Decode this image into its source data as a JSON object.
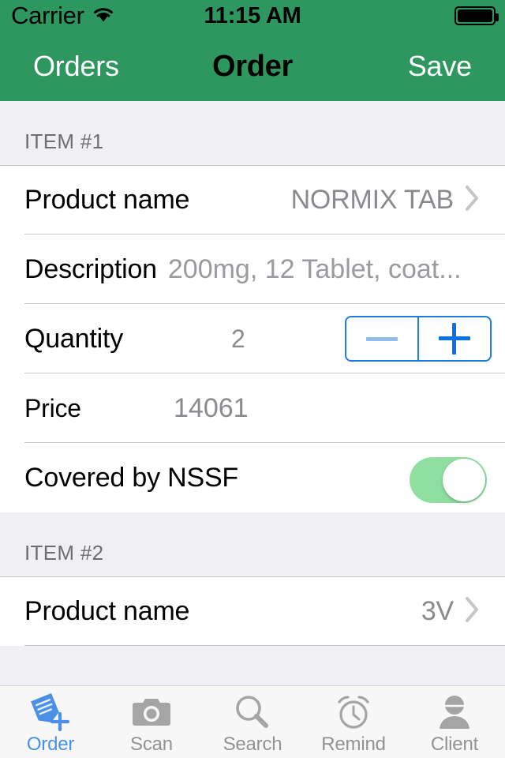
{
  "statusbar": {
    "carrier": "Carrier",
    "wifi_icon": "wifi-icon",
    "time": "11:15 AM",
    "battery_icon": "battery-full-icon"
  },
  "navbar": {
    "back_label": "Orders",
    "title": "Order",
    "save_label": "Save"
  },
  "colors": {
    "navbar_green": "#2E9760",
    "section_bg": "#EFEFF4",
    "accent_blue": "#0A72E8",
    "toggle_on_green": "#8FDFA0",
    "tab_active_blue": "#4A90E8",
    "separator": "#C8C7CC",
    "value_gray": "#8A8A8F"
  },
  "sections": [
    {
      "header": "ITEM #1",
      "rows": {
        "product_name": {
          "label": "Product name",
          "value": "NORMIX TAB",
          "chevron": "chevron-right-icon"
        },
        "description": {
          "label": "Description",
          "value": "200mg, 12 Tablet, coat..."
        },
        "quantity": {
          "label": "Quantity",
          "value": "2",
          "minus_label": "−",
          "plus_label": "+"
        },
        "price": {
          "label": "Price",
          "value": "14061"
        },
        "nssf": {
          "label": "Covered by NSSF",
          "state": "on"
        }
      }
    },
    {
      "header": "ITEM #2",
      "rows": {
        "product_name": {
          "label": "Product name",
          "value": "3V",
          "chevron": "chevron-right-icon"
        }
      }
    }
  ],
  "tabbar": {
    "items": [
      {
        "label": "Order",
        "icon": "order-note-plus-icon",
        "active": true
      },
      {
        "label": "Scan",
        "icon": "camera-icon",
        "active": false
      },
      {
        "label": "Search",
        "icon": "magnifier-icon",
        "active": false
      },
      {
        "label": "Remind",
        "icon": "alarm-clock-icon",
        "active": false
      },
      {
        "label": "Client",
        "icon": "person-icon",
        "active": false
      }
    ]
  }
}
